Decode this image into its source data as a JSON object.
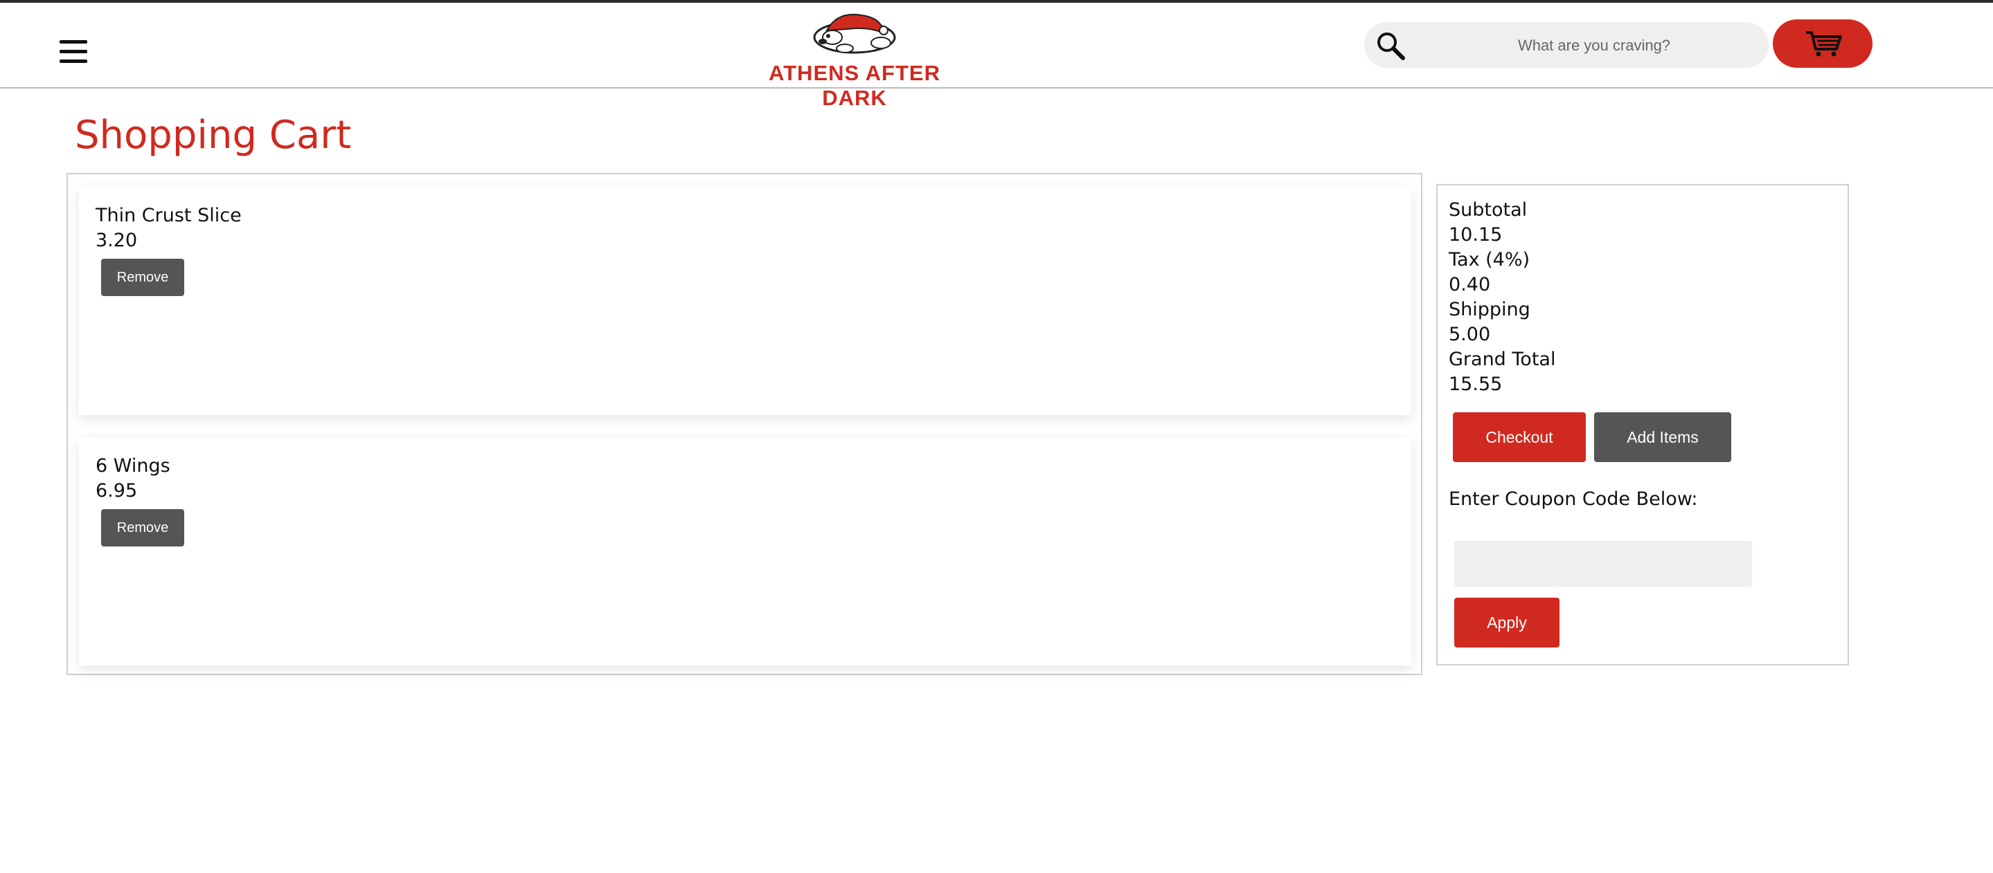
{
  "header": {
    "menu_icon": "hamburger-icon",
    "logo_text": "ATHENS AFTER DARK",
    "search": {
      "placeholder": "What are you craving?",
      "value": "",
      "icon": "search-icon"
    },
    "cart_icon": "cart-icon"
  },
  "page": {
    "title": "Shopping Cart"
  },
  "cart": {
    "items": [
      {
        "name": "Thin Crust Slice",
        "price": "3.20",
        "remove_label": "Remove"
      },
      {
        "name": "6 Wings",
        "price": "6.95",
        "remove_label": "Remove"
      }
    ]
  },
  "summary": {
    "subtotal_label": "Subtotal",
    "subtotal_value": "10.15",
    "tax_label": "Tax (4%)",
    "tax_value": "0.40",
    "shipping_label": "Shipping",
    "shipping_value": "5.00",
    "grand_total_label": "Grand Total",
    "grand_total_value": "15.55",
    "checkout_label": "Checkout",
    "add_items_label": "Add Items",
    "coupon_prompt": "Enter Coupon Code Below:",
    "coupon_value": "",
    "apply_label": "Apply"
  },
  "colors": {
    "brand_red": "#d02a20",
    "button_gray": "#555555",
    "input_gray": "#efefef"
  }
}
